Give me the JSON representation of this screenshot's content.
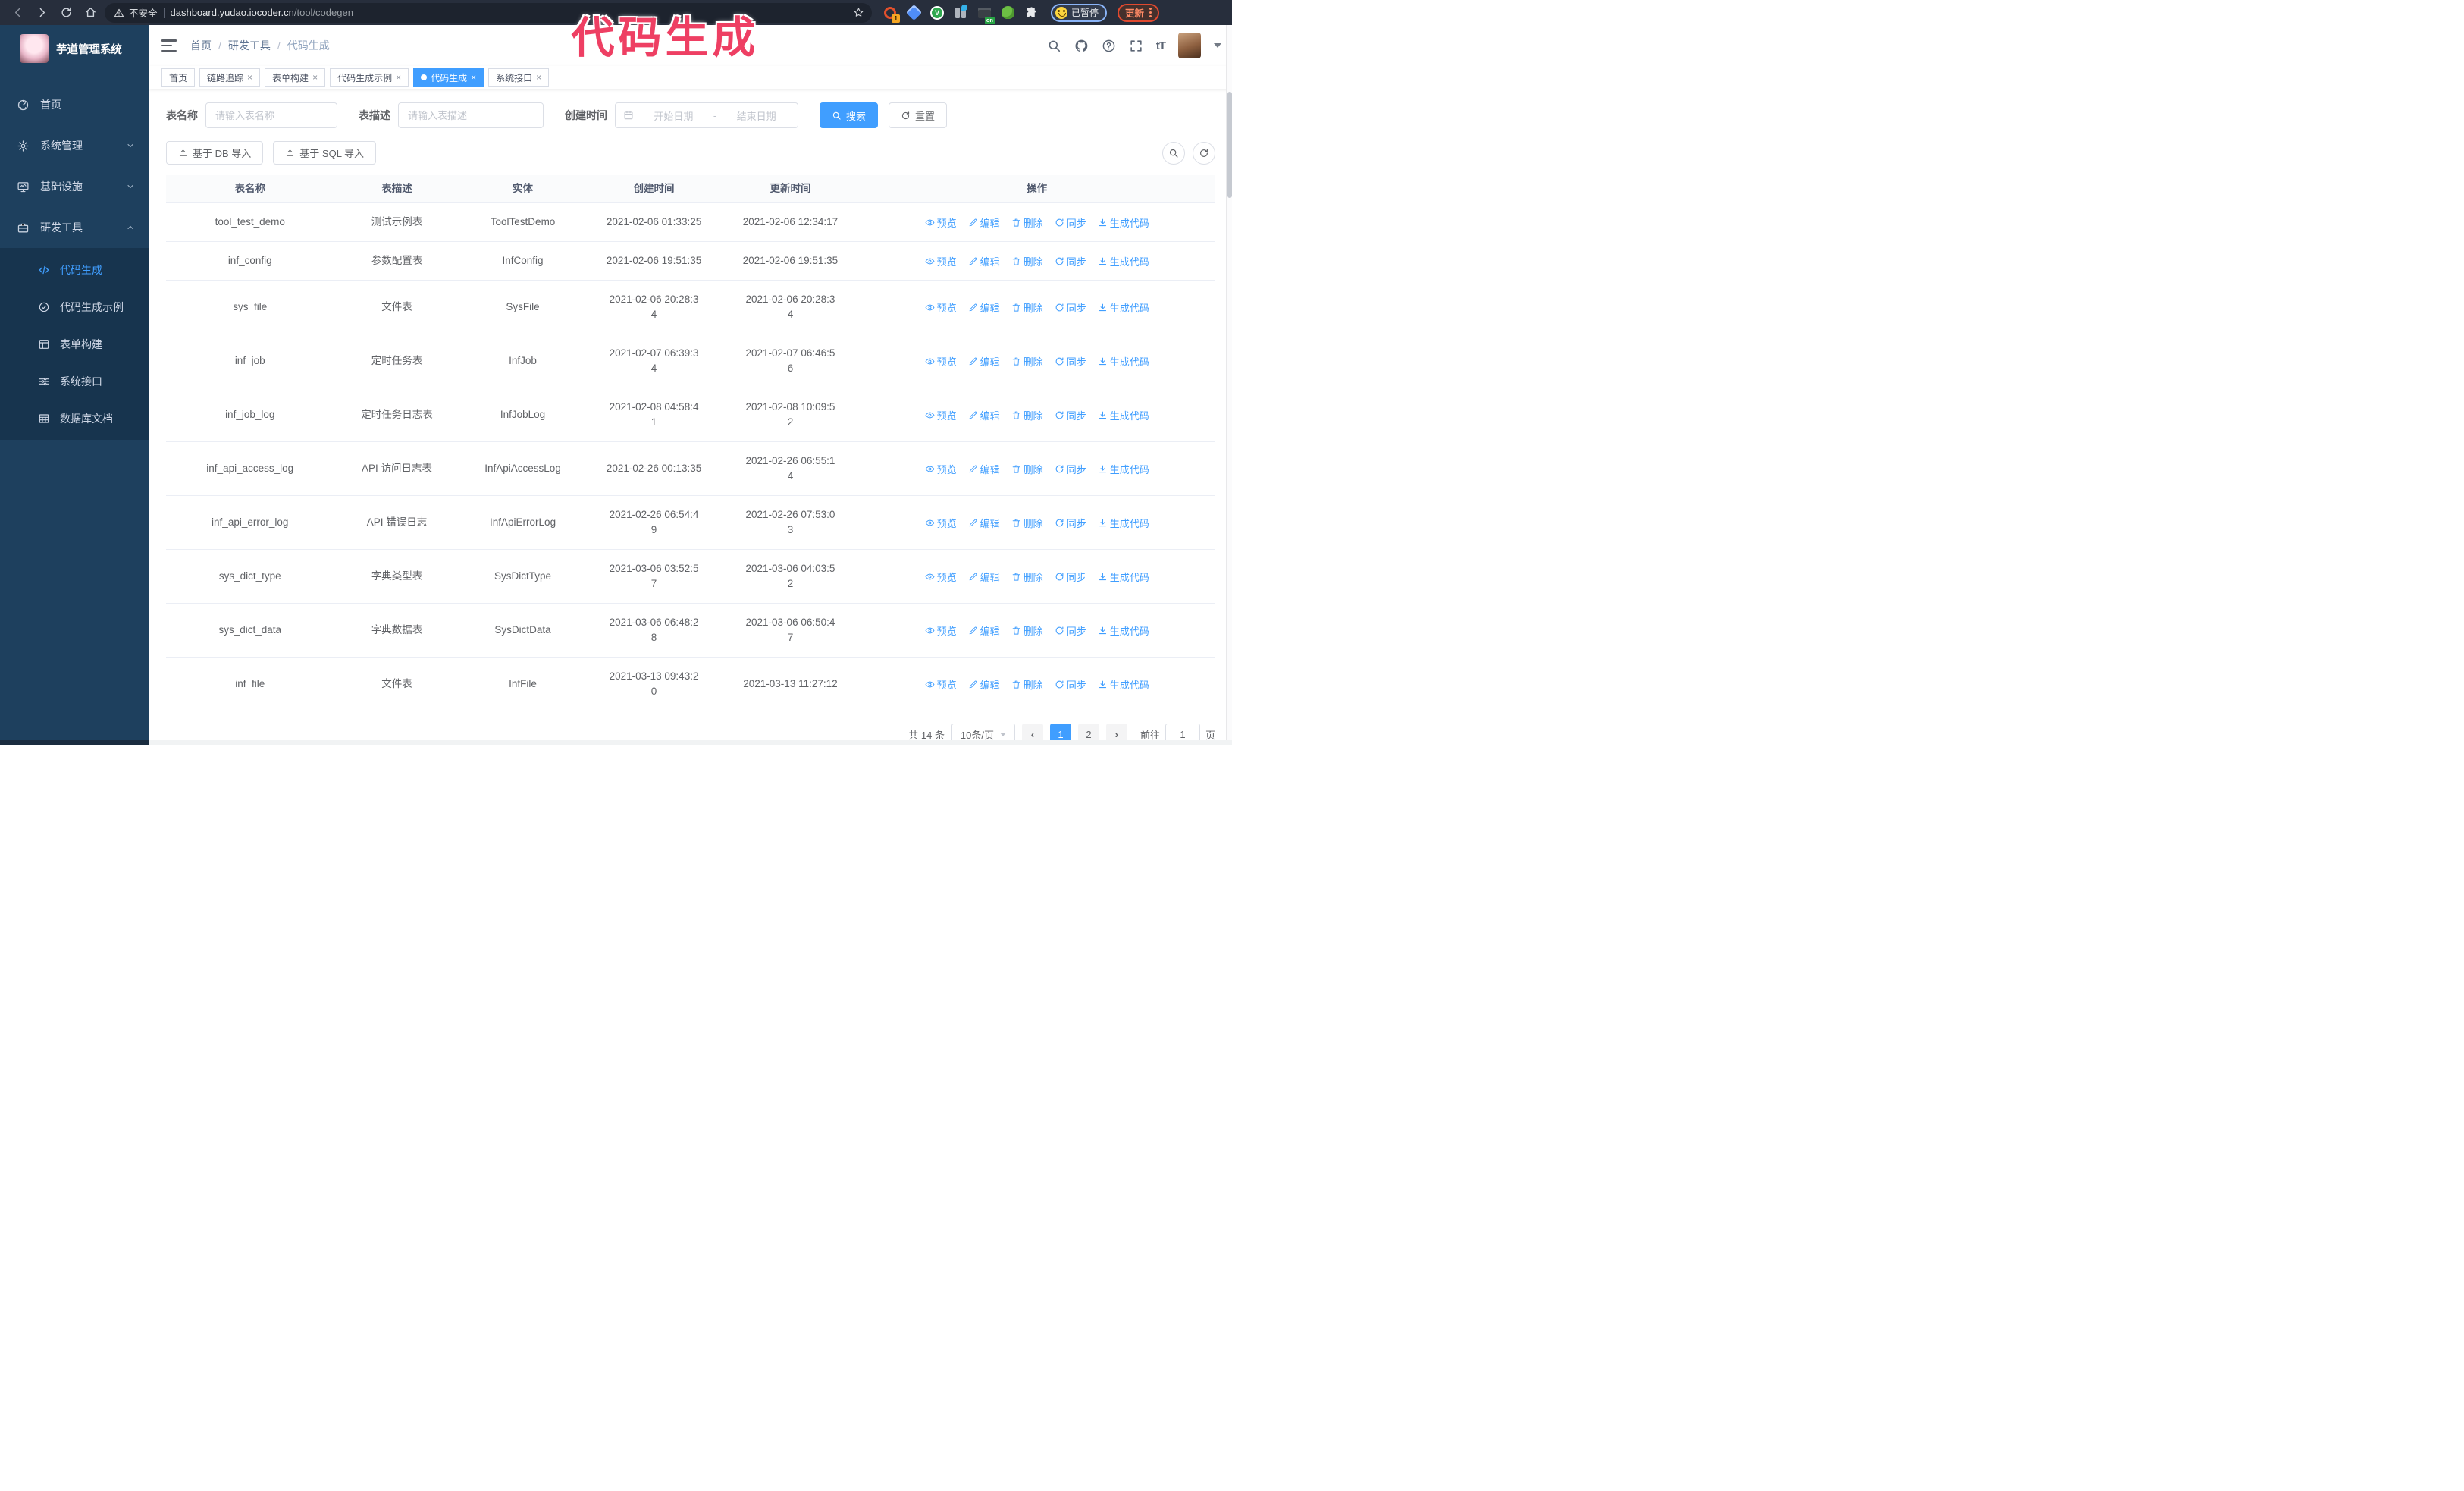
{
  "browser": {
    "security_label": "不安全",
    "url_domain": "dashboard.yudao.iocoder.cn",
    "url_path": "/tool/codegen",
    "extension_badge_1": "1",
    "extension_badge_v": "V",
    "extension_badge_on": "on",
    "paused_label": "已暂停",
    "update_label": "更新"
  },
  "overlay": {
    "annotation": "代码生成"
  },
  "sidebar": {
    "title": "芋道管理系统",
    "items": [
      {
        "label": "首页"
      },
      {
        "label": "系统管理"
      },
      {
        "label": "基础设施"
      },
      {
        "label": "研发工具"
      }
    ],
    "submenu": [
      {
        "label": "代码生成",
        "active": true
      },
      {
        "label": "代码生成示例"
      },
      {
        "label": "表单构建"
      },
      {
        "label": "系统接口"
      },
      {
        "label": "数据库文档"
      }
    ]
  },
  "breadcrumb": {
    "items": [
      "首页",
      "研发工具",
      "代码生成"
    ]
  },
  "tabs": [
    {
      "label": "首页"
    },
    {
      "label": "链路追踪"
    },
    {
      "label": "表单构建"
    },
    {
      "label": "代码生成示例"
    },
    {
      "label": "代码生成",
      "active": true
    },
    {
      "label": "系统接口"
    }
  ],
  "filters": {
    "name_label": "表名称",
    "name_placeholder": "请输入表名称",
    "desc_label": "表描述",
    "desc_placeholder": "请输入表描述",
    "time_label": "创建时间",
    "start_placeholder": "开始日期",
    "range_separator": "-",
    "end_placeholder": "结束日期",
    "search_label": "搜索",
    "reset_label": "重置"
  },
  "toolbar": {
    "db_import_label": "基于 DB 导入",
    "sql_import_label": "基于 SQL 导入"
  },
  "table": {
    "columns": [
      "表名称",
      "表描述",
      "实体",
      "创建时间",
      "更新时间",
      "操作"
    ],
    "action_labels": [
      "预览",
      "编辑",
      "删除",
      "同步",
      "生成代码"
    ],
    "rows": [
      {
        "name": "tool_test_demo",
        "description": "测试示例表",
        "entity": "ToolTestDemo",
        "created": "2021-02-06 01:33:25",
        "updated": "2021-02-06 12:34:17"
      },
      {
        "name": "inf_config",
        "description": "参数配置表",
        "entity": "InfConfig",
        "created": "2021-02-06 19:51:35",
        "updated": "2021-02-06 19:51:35"
      },
      {
        "name": "sys_file",
        "description": "文件表",
        "entity": "SysFile",
        "created": "2021-02-06 20:28:3\n4",
        "updated": "2021-02-06 20:28:3\n4"
      },
      {
        "name": "inf_job",
        "description": "定时任务表",
        "entity": "InfJob",
        "created": "2021-02-07 06:39:3\n4",
        "updated": "2021-02-07 06:46:5\n6"
      },
      {
        "name": "inf_job_log",
        "description": "定时任务日志表",
        "entity": "InfJobLog",
        "created": "2021-02-08 04:58:4\n1",
        "updated": "2021-02-08 10:09:5\n2"
      },
      {
        "name": "inf_api_access_log",
        "description": "API 访问日志表",
        "entity": "InfApiAccessLog",
        "created": "2021-02-26 00:13:35",
        "updated": "2021-02-26 06:55:1\n4"
      },
      {
        "name": "inf_api_error_log",
        "description": "API 错误日志",
        "entity": "InfApiErrorLog",
        "created": "2021-02-26 06:54:4\n9",
        "updated": "2021-02-26 07:53:0\n3"
      },
      {
        "name": "sys_dict_type",
        "description": "字典类型表",
        "entity": "SysDictType",
        "created": "2021-03-06 03:52:5\n7",
        "updated": "2021-03-06 04:03:5\n2"
      },
      {
        "name": "sys_dict_data",
        "description": "字典数据表",
        "entity": "SysDictData",
        "created": "2021-03-06 06:48:2\n8",
        "updated": "2021-03-06 06:50:4\n7"
      },
      {
        "name": "inf_file",
        "description": "文件表",
        "entity": "InfFile",
        "created": "2021-03-13 09:43:2\n0",
        "updated": "2021-03-13 11:27:12"
      }
    ]
  },
  "pagination": {
    "total_label": "共 14 条",
    "page_size_label": "10条/页",
    "pages": [
      "1",
      "2"
    ],
    "active_page": "1",
    "goto_label": "前往",
    "goto_value": "1",
    "page_unit_label": "页"
  },
  "colors": {
    "accent": "#409eff",
    "sidebar_bg": "#1e405e",
    "submenu_bg": "#17344e",
    "chrome_bg": "#272e3c",
    "annotation": "#ee3f63"
  }
}
